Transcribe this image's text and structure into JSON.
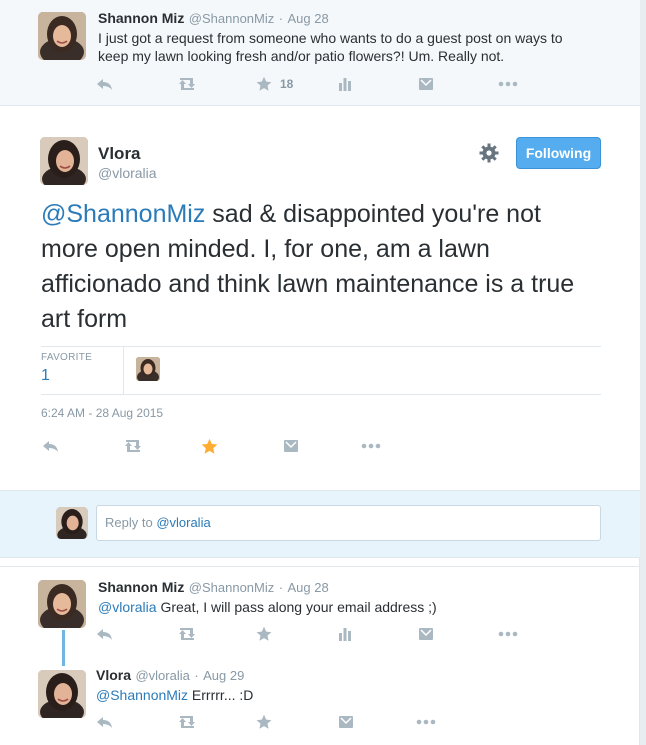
{
  "tweet1": {
    "name": "Shannon Miz",
    "handle": "@ShannonMiz",
    "dot": "·",
    "time": "Aug 28",
    "text": "I just got a request from someone who wants to do a guest post on ways to keep my lawn looking fresh and/or patio flowers?! Um. Really not.",
    "favorite_count": "18"
  },
  "main": {
    "name": "Vlora",
    "handle": "@vloralia",
    "follow_label": "Following",
    "mention": "@ShannonMiz",
    "text": " sad & disappointed you're not more open minded. I, for one, am a lawn afficionado and think lawn maintenance is a true art form",
    "favorite_label": "FAVORITE",
    "favorite_count": "1",
    "date": "6:24 AM - 28 Aug 2015"
  },
  "reply_box": {
    "prefix": "Reply to ",
    "mention": "@vloralia"
  },
  "reply1": {
    "name": "Shannon Miz",
    "handle": "@ShannonMiz",
    "dot": "·",
    "time": "Aug 28",
    "mention": "@vloralia",
    "text": " Great, I will pass along your email address ;)"
  },
  "reply2": {
    "name": "Vlora",
    "handle": "@vloralia",
    "dot": "·",
    "time": "Aug 29",
    "mention": "@ShannonMiz",
    "text": " Errrrr... :D"
  },
  "colors": {
    "accent": "#55acee",
    "link": "#2b7bb9",
    "favorited": "#ffac33",
    "icon": "#aab8c2"
  }
}
